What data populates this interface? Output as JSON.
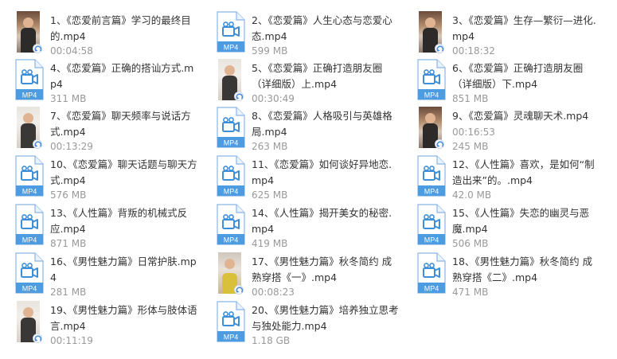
{
  "files": [
    {
      "name": "1、《恋爱前言篇》学习的最终目的.mp4",
      "meta": "00:04:58",
      "thumb": "video",
      "tone": "dark"
    },
    {
      "name": "2、《恋爱篇》人生心态与恋爱心态.mp4",
      "meta": "599 MB",
      "thumb": "file"
    },
    {
      "name": "3、《恋爱篇》生存—繁衍—进化.mp4",
      "meta": "00:18:32",
      "thumb": "video",
      "tone": "dark"
    },
    {
      "name": "4、《恋爱篇》正确的搭讪方式.mp4",
      "meta": "311 MB",
      "thumb": "file"
    },
    {
      "name": "5、《恋爱篇》正确打造朋友圈 （详细版）上.mp4",
      "meta": "00:30:49",
      "thumb": "video",
      "tone": "light"
    },
    {
      "name": "6、《恋爱篇》正确打造朋友圈（详细版）下.mp4",
      "meta": "851 MB",
      "thumb": "file"
    },
    {
      "name": "7、《恋爱篇》聊天频率与说话方式.mp4",
      "meta": "00:13:29",
      "thumb": "video",
      "tone": "light"
    },
    {
      "name": "8、《恋爱篇》人格吸引与英雄格局.mp4",
      "meta": "263 MB",
      "thumb": "file"
    },
    {
      "name": "9、《恋爱篇》灵魂聊天术.mp4",
      "meta": "00:16:53",
      "extra": "245 MB",
      "thumb": "video",
      "tone": "dark"
    },
    {
      "name": "10、《恋爱篇》聊天话题与聊天方式.mp4",
      "meta": "576 MB",
      "thumb": "file"
    },
    {
      "name": "11、《恋爱篇》如何谈好异地恋.mp4",
      "meta": "625 MB",
      "thumb": "file"
    },
    {
      "name": "12、《人性篇》喜欢，是如何“制造出来”的。.mp4",
      "meta": "42.0 MB",
      "thumb": "file"
    },
    {
      "name": "13、《人性篇》背叛的机械式反应.mp4",
      "meta": "871 MB",
      "thumb": "file"
    },
    {
      "name": "14、《人性篇》揭开美女的秘密.mp4",
      "meta": "419 MB",
      "thumb": "file"
    },
    {
      "name": "15、《人性篇》失恋的幽灵与恶魔.mp4",
      "meta": "506 MB",
      "thumb": "file"
    },
    {
      "name": "16、《男性魅力篇》日常护肤.mp4",
      "meta": "281 MB",
      "thumb": "file"
    },
    {
      "name": "17、《男性魅力篇》秋冬简约 成熟穿搭《一》.mp4",
      "meta": "00:08:23",
      "thumb": "video",
      "tone": "warm"
    },
    {
      "name": "18、《男性魅力篇》秋冬简约 成熟穿搭《二》.mp4",
      "meta": "471 MB",
      "thumb": "file"
    },
    {
      "name": "19、《男性魅力篇》形体与肢体语言.mp4",
      "meta": "00:11:19",
      "thumb": "video",
      "tone": "light"
    },
    {
      "name": "20、《男性魅力篇》培养独立思考与独处能力.mp4",
      "meta": "1.18 GB",
      "thumb": "file"
    }
  ],
  "file_icon_label": "MP4",
  "colors": {
    "icon_blue": "#3f8fd8",
    "label_band": "#4d9be0",
    "text": "#333333",
    "meta": "#999999"
  }
}
